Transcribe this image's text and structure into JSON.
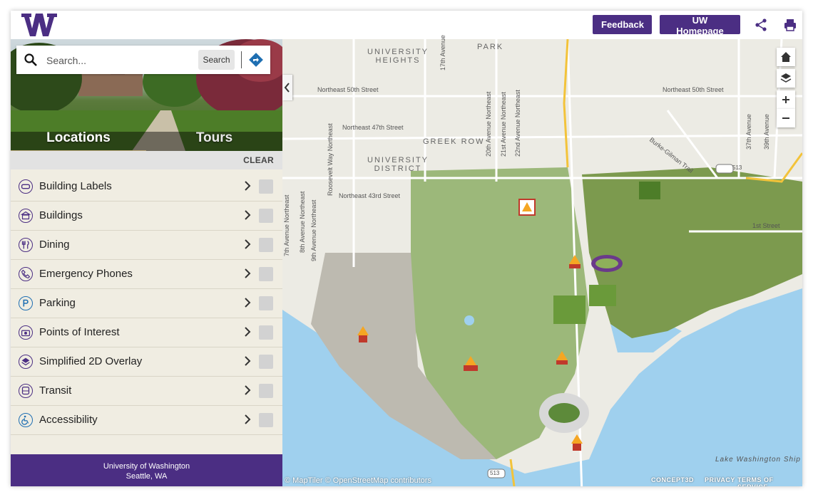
{
  "header": {
    "feedback_label": "Feedback",
    "homepage_label": "UW Homepage",
    "brand_color": "#4b2e83",
    "icons": [
      "uw-logo",
      "share-icon",
      "print-icon"
    ]
  },
  "search": {
    "placeholder": "Search...",
    "button_label": "Search"
  },
  "tabs": {
    "locations": "Locations",
    "tours": "Tours"
  },
  "clear_label": "CLEAR",
  "categories": [
    {
      "label": "Building Labels",
      "icon": "label-icon"
    },
    {
      "label": "Buildings",
      "icon": "building-icon"
    },
    {
      "label": "Dining",
      "icon": "dining-icon"
    },
    {
      "label": "Emergency Phones",
      "icon": "phone-icon"
    },
    {
      "label": "Parking",
      "icon": "parking-icon"
    },
    {
      "label": "Points of Interest",
      "icon": "camera-icon"
    },
    {
      "label": "Simplified 2D Overlay",
      "icon": "overlay-icon"
    },
    {
      "label": "Transit",
      "icon": "bus-icon"
    },
    {
      "label": "Accessibility",
      "icon": "accessibility-icon"
    }
  ],
  "footer": {
    "line1": "University of Washington",
    "line2": "Seattle, WA"
  },
  "map": {
    "labels": {
      "university_heights": "UNIVERSITY\nHEIGHTS",
      "park": "PARK",
      "greek_row": "GREEK ROW",
      "university_district": "UNIVERSITY\nDISTRICT",
      "ne50_left": "Northeast 50th Street",
      "ne50_right": "Northeast 50th Street",
      "ne47": "Northeast 47th Street",
      "ne43": "Northeast 43rd Street",
      "roosevelt": "Roosevelt Way Northeast",
      "ave7": "7th Avenue Northeast",
      "ave8": "8th Avenue Northeast",
      "ave9": "9th Avenue Northeast",
      "ave17": "17th Avenue",
      "ave20": "20th Avenue Northeast",
      "ave21": "21st Avenue Northeast",
      "ave22": "22nd Avenue Northeast",
      "burke": "Burke-Gilman Trail",
      "ave37": "37th Avenue",
      "ave39": "39th Avenue",
      "first_street": "1st Street",
      "lake": "Lake Washington Ship",
      "route513a": "513",
      "route513b": "513"
    },
    "attribution": "© MapTiler © OpenStreetMap contributors",
    "brand": "CONCEPT3D",
    "privacy": "PRIVACY",
    "terms": "TERMS OF SERVICE"
  }
}
